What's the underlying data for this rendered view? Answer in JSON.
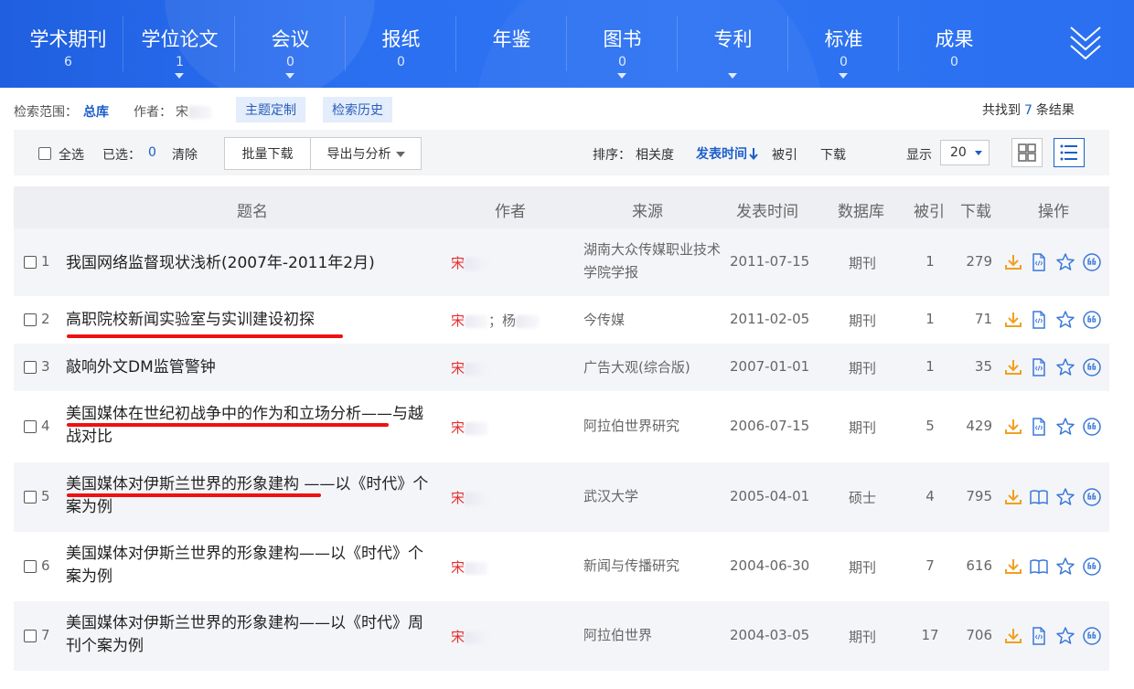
{
  "categories": [
    {
      "name": "学术期刊",
      "count": "6",
      "caret": false
    },
    {
      "name": "学位论文",
      "count": "1",
      "caret": true
    },
    {
      "name": "会议",
      "count": "0",
      "caret": true
    },
    {
      "name": "报纸",
      "count": "0",
      "caret": false
    },
    {
      "name": "年鉴",
      "count": "",
      "caret": false
    },
    {
      "name": "图书",
      "count": "0",
      "caret": true
    },
    {
      "name": "专利",
      "count": "",
      "caret": true
    },
    {
      "name": "标准",
      "count": "0",
      "caret": true
    },
    {
      "name": "成果",
      "count": "0",
      "caret": false
    }
  ],
  "search": {
    "scope_label": "检索范围：",
    "scope_value": "总库",
    "author_label": "作者：",
    "author_value": "宋",
    "topic_button": "主题定制",
    "history_button": "检索历史",
    "result_prefix": "共找到",
    "result_count": "7",
    "result_suffix": "条结果"
  },
  "toolbar": {
    "select_all": "全选",
    "selected_label": "已选：",
    "selected_count": "0",
    "clear": "清除",
    "batch_download": "批量下载",
    "export_analyze": "导出与分析",
    "sort_label": "排序：",
    "sort_relevance": "相关度",
    "sort_date": "发表时间",
    "sort_cited": "被引",
    "sort_download": "下载",
    "display_label": "显示",
    "page_size": "20"
  },
  "table": {
    "headers": [
      "题名",
      "作者",
      "来源",
      "发表时间",
      "数据库",
      "被引",
      "下载",
      "操作"
    ],
    "rows": [
      {
        "index": "1",
        "title": "我国网络监督现状浅析(2007年-2011年2月)",
        "author_main": "宋",
        "author_other": "",
        "source": "湖南大众传媒职业技术学院学报",
        "date": "2011-07-15",
        "db": "期刊",
        "cited": "1",
        "downloads": "279",
        "read_icon": "html-icon"
      },
      {
        "index": "2",
        "title": "高职院校新闻实验室与实训建设初探",
        "author_main": "宋",
        "author_other": "杨",
        "source": "今传媒",
        "date": "2011-02-05",
        "db": "期刊",
        "cited": "1",
        "downloads": "71",
        "read_icon": "html-icon"
      },
      {
        "index": "3",
        "title": "敲响外文DM监管警钟",
        "author_main": "宋",
        "author_other": "",
        "source": "广告大观(综合版)",
        "date": "2007-01-01",
        "db": "期刊",
        "cited": "1",
        "downloads": "35",
        "read_icon": "html-icon"
      },
      {
        "index": "4",
        "title": "美国媒体在世纪初战争中的作为和立场分析——与越战对比",
        "author_main": "宋",
        "author_other": "",
        "source": "阿拉伯世界研究",
        "date": "2006-07-15",
        "db": "期刊",
        "cited": "5",
        "downloads": "429",
        "read_icon": "html-icon"
      },
      {
        "index": "5",
        "title": "美国媒体对伊斯兰世界的形象建构 ——以《时代》个案为例",
        "author_main": "宋",
        "author_other": "",
        "source": "武汉大学",
        "date": "2005-04-01",
        "db": "硕士",
        "cited": "4",
        "downloads": "795",
        "read_icon": "book-icon"
      },
      {
        "index": "6",
        "title": "美国媒体对伊斯兰世界的形象建构——以《时代》个案为例",
        "author_main": "宋",
        "author_other": "",
        "source": "新闻与传播研究",
        "date": "2004-06-30",
        "db": "期刊",
        "cited": "7",
        "downloads": "616",
        "read_icon": "book-icon"
      },
      {
        "index": "7",
        "title": "美国媒体对伊斯兰世界的形象建构——以《时代》周刊个案为例",
        "author_main": "宋",
        "author_other": "",
        "source": "阿拉伯世界",
        "date": "2004-03-05",
        "db": "期刊",
        "cited": "17",
        "downloads": "706",
        "read_icon": "html-icon"
      }
    ]
  },
  "colors": {
    "brand_blue": "#2a6ff0",
    "link_blue": "#1c5fc9",
    "author_red": "#e62b2b",
    "annotation_red": "#e11111",
    "download_orange": "#f0a020"
  }
}
